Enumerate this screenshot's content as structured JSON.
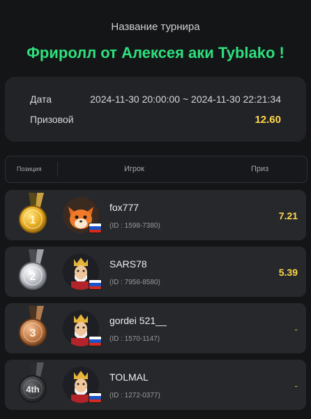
{
  "header": {
    "subtitle": "Название турнира",
    "title": "Фриролл от Алексея аки  Tyblako !"
  },
  "info": {
    "date_label": "Дата",
    "date_value": "2024-11-30 20:00:00 ~ 2024-11-30 22:21:34",
    "prize_label": "Призовой",
    "prize_value": "12.60"
  },
  "table": {
    "col_position": "Позиция",
    "col_player": "Игрок",
    "col_prize": "Приз"
  },
  "rows": [
    {
      "place": "1",
      "medal": "gold-medal",
      "name": "fox777",
      "id": "(ID : 1598-7380)",
      "prize": "7.21",
      "avatar": "fox-avatar"
    },
    {
      "place": "2",
      "medal": "silver-medal",
      "name": "SARS78",
      "id": "(ID : 7956-8580)",
      "prize": "5.39",
      "avatar": "king-avatar"
    },
    {
      "place": "3",
      "medal": "bronze-medal",
      "name": "gordei 521__",
      "id": "(ID : 1570-1147)",
      "prize": "-",
      "avatar": "king-avatar"
    },
    {
      "place": "4th",
      "medal": "dark-medal",
      "name": "TOLMAL",
      "id": "(ID : 1272-0377)",
      "prize": "-",
      "avatar": "king-avatar"
    }
  ],
  "colors": {
    "accent_green": "#2ee07d",
    "prize_yellow": "#ffd84a",
    "background": "#141517",
    "card": "#26282c"
  }
}
